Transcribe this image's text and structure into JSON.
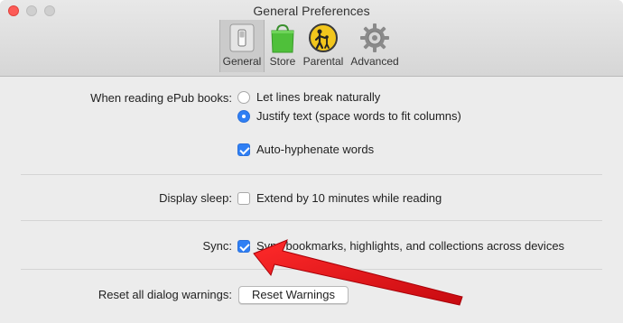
{
  "window": {
    "title": "General Preferences"
  },
  "toolbar": {
    "tabs": [
      {
        "label": "General",
        "icon": "general-switch-icon"
      },
      {
        "label": "Store",
        "icon": "store-bag-icon"
      },
      {
        "label": "Parental",
        "icon": "parental-controls-icon"
      },
      {
        "label": "Advanced",
        "icon": "gear-icon"
      }
    ],
    "selected": "General"
  },
  "epub": {
    "label": "When reading ePub books:",
    "options": [
      {
        "text": "Let lines break naturally",
        "selected": false
      },
      {
        "text": "Justify text (space words to fit columns)",
        "selected": true
      }
    ],
    "hyphenate": {
      "text": "Auto-hyphenate words",
      "checked": true
    }
  },
  "display_sleep": {
    "label": "Display sleep:",
    "option": {
      "text": "Extend by 10 minutes while reading",
      "checked": false
    }
  },
  "sync": {
    "label": "Sync:",
    "option": {
      "text": "Sync bookmarks, highlights, and collections across devices",
      "checked": true
    }
  },
  "reset": {
    "label": "Reset all dialog warnings:",
    "button": "Reset Warnings"
  },
  "colors": {
    "accent": "#2f7ff4",
    "close": "#fc5b57",
    "arrow": "#e0141b"
  }
}
